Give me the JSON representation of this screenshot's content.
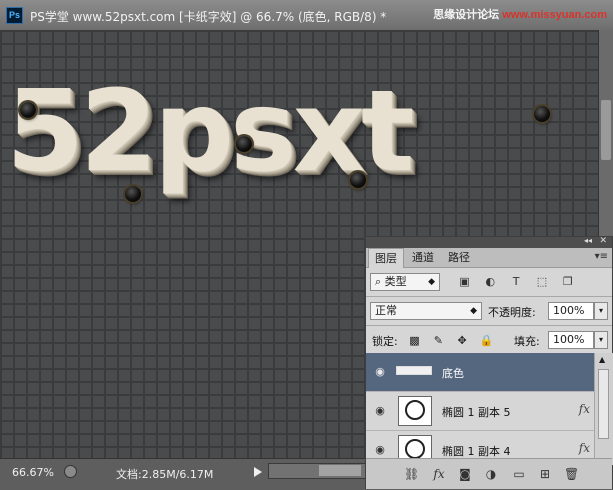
{
  "titlebar": {
    "title": "PS学堂 www.52psxt.com [卡纸字效] @ 66.7% (底色, RGB/8) *",
    "app_logo": "Ps",
    "watermark_prefix": "思缘设计论坛 ",
    "watermark_site": "www.missyuan.com"
  },
  "canvas": {
    "art_text": "52psxt"
  },
  "statusbar": {
    "zoom": "66.67%",
    "doc_info": "文档:2.85M/6.17M"
  },
  "layers_panel": {
    "tabs": [
      {
        "label": "图层",
        "active": true
      },
      {
        "label": "通道",
        "active": false
      },
      {
        "label": "路径",
        "active": false
      }
    ],
    "filter_label": "类型",
    "blend_mode": "正常",
    "opacity_label": "不透明度:",
    "opacity_value": "100%",
    "lock_label": "锁定:",
    "fill_label": "填充:",
    "fill_value": "100%",
    "layers": [
      {
        "name": "底色",
        "selected": true,
        "fx": ""
      },
      {
        "name": "椭圆 1 副本 5",
        "selected": false,
        "fx": "fx"
      },
      {
        "name": "椭圆 1 副本 4",
        "selected": false,
        "fx": "fx"
      }
    ]
  },
  "colors": {
    "canvas_bg": "#4a4b4d",
    "grid_line": "#3a3b3d",
    "selected_layer": "#55677f",
    "letter_face": "#e8e1d2"
  }
}
